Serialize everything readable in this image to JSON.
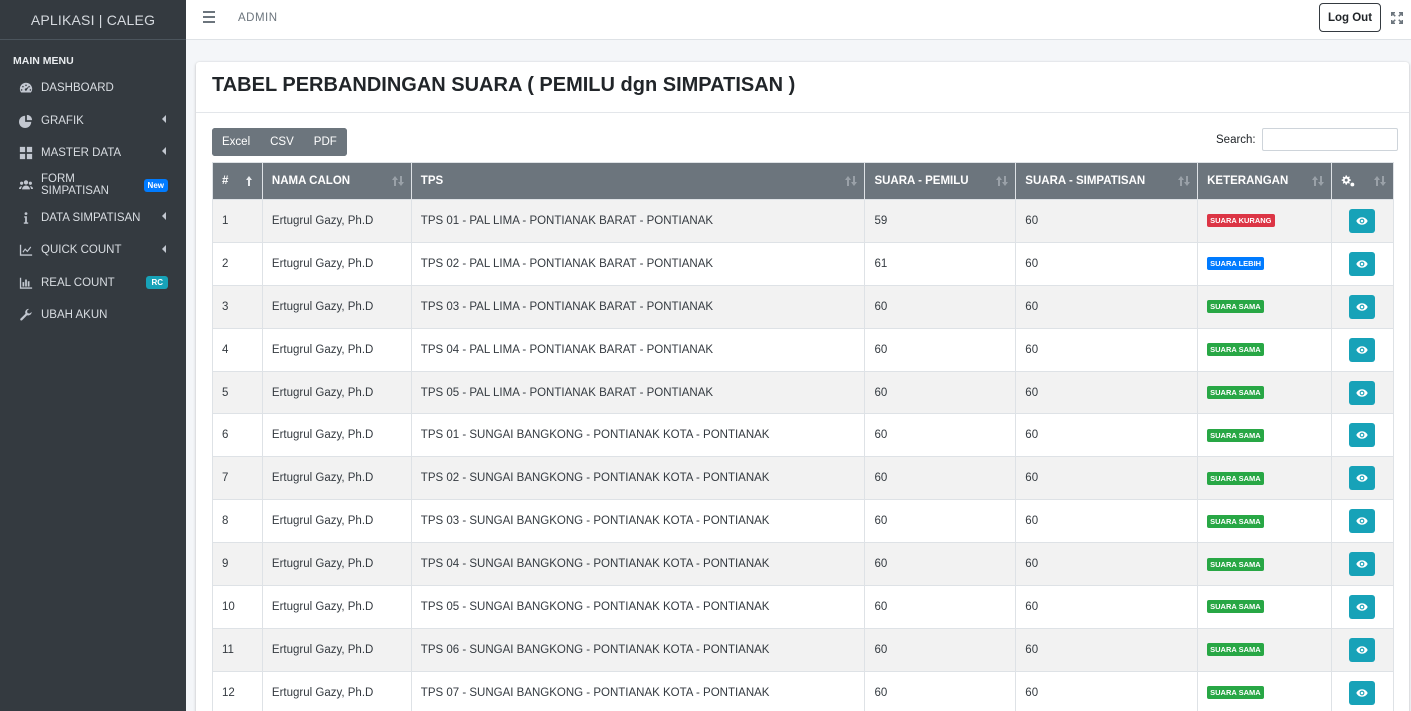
{
  "brand": "APLIKASI | CALEG",
  "sidebar": {
    "header": "MAIN MENU",
    "items": [
      {
        "label": "DASHBOARD",
        "icon": "tachometer-icon",
        "chevron": false,
        "badge": ""
      },
      {
        "label": "GRAFIK",
        "icon": "pie-chart-icon",
        "chevron": true,
        "badge": ""
      },
      {
        "label": "MASTER DATA",
        "icon": "th-large-icon",
        "chevron": true,
        "badge": ""
      },
      {
        "label": "FORM SIMPATISAN",
        "icon": "users-icon",
        "chevron": false,
        "badge": "New"
      },
      {
        "label": "DATA SIMPATISAN",
        "icon": "info-icon",
        "chevron": true,
        "badge": ""
      },
      {
        "label": "QUICK COUNT",
        "icon": "line-chart-icon",
        "chevron": true,
        "badge": ""
      },
      {
        "label": "REAL COUNT",
        "icon": "bar-chart-icon",
        "chevron": false,
        "badge": "RC"
      },
      {
        "label": "UBAH AKUN",
        "icon": "wrench-icon",
        "chevron": false,
        "badge": ""
      }
    ]
  },
  "topbar": {
    "user": "ADMIN",
    "logout_label": "Log Out"
  },
  "card": {
    "title": "TABEL PERBANDINGAN SUARA ( PEMILU dgn SIMPATISAN )"
  },
  "export_buttons": {
    "excel": "Excel",
    "csv": "CSV",
    "pdf": "PDF"
  },
  "search": {
    "label": "Search:",
    "value": ""
  },
  "table": {
    "headers": [
      "#",
      "NAMA CALON",
      "TPS",
      "SUARA - PEMILU",
      "SUARA - SIMPATISAN",
      "KETERANGAN"
    ],
    "rows": [
      {
        "no": "1",
        "nama": "Ertugrul Gazy, Ph.D",
        "tps": "TPS 01 - PAL LIMA - PONTIANAK BARAT - PONTIANAK",
        "pemilu": "59",
        "simpatisan": "60",
        "ket": "SUARA KURANG",
        "status": "kurang"
      },
      {
        "no": "2",
        "nama": "Ertugrul Gazy, Ph.D",
        "tps": "TPS 02 - PAL LIMA - PONTIANAK BARAT - PONTIANAK",
        "pemilu": "61",
        "simpatisan": "60",
        "ket": "SUARA LEBIH",
        "status": "lebih"
      },
      {
        "no": "3",
        "nama": "Ertugrul Gazy, Ph.D",
        "tps": "TPS 03 - PAL LIMA - PONTIANAK BARAT - PONTIANAK",
        "pemilu": "60",
        "simpatisan": "60",
        "ket": "SUARA SAMA",
        "status": "sama"
      },
      {
        "no": "4",
        "nama": "Ertugrul Gazy, Ph.D",
        "tps": "TPS 04 - PAL LIMA - PONTIANAK BARAT - PONTIANAK",
        "pemilu": "60",
        "simpatisan": "60",
        "ket": "SUARA SAMA",
        "status": "sama"
      },
      {
        "no": "5",
        "nama": "Ertugrul Gazy, Ph.D",
        "tps": "TPS 05 - PAL LIMA - PONTIANAK BARAT - PONTIANAK",
        "pemilu": "60",
        "simpatisan": "60",
        "ket": "SUARA SAMA",
        "status": "sama"
      },
      {
        "no": "6",
        "nama": "Ertugrul Gazy, Ph.D",
        "tps": "TPS 01 - SUNGAI BANGKONG - PONTIANAK KOTA - PONTIANAK",
        "pemilu": "60",
        "simpatisan": "60",
        "ket": "SUARA SAMA",
        "status": "sama"
      },
      {
        "no": "7",
        "nama": "Ertugrul Gazy, Ph.D",
        "tps": "TPS 02 - SUNGAI BANGKONG - PONTIANAK KOTA - PONTIANAK",
        "pemilu": "60",
        "simpatisan": "60",
        "ket": "SUARA SAMA",
        "status": "sama"
      },
      {
        "no": "8",
        "nama": "Ertugrul Gazy, Ph.D",
        "tps": "TPS 03 - SUNGAI BANGKONG - PONTIANAK KOTA - PONTIANAK",
        "pemilu": "60",
        "simpatisan": "60",
        "ket": "SUARA SAMA",
        "status": "sama"
      },
      {
        "no": "9",
        "nama": "Ertugrul Gazy, Ph.D",
        "tps": "TPS 04 - SUNGAI BANGKONG - PONTIANAK KOTA - PONTIANAK",
        "pemilu": "60",
        "simpatisan": "60",
        "ket": "SUARA SAMA",
        "status": "sama"
      },
      {
        "no": "10",
        "nama": "Ertugrul Gazy, Ph.D",
        "tps": "TPS 05 - SUNGAI BANGKONG - PONTIANAK KOTA - PONTIANAK",
        "pemilu": "60",
        "simpatisan": "60",
        "ket": "SUARA SAMA",
        "status": "sama"
      },
      {
        "no": "11",
        "nama": "Ertugrul Gazy, Ph.D",
        "tps": "TPS 06 - SUNGAI BANGKONG - PONTIANAK KOTA - PONTIANAK",
        "pemilu": "60",
        "simpatisan": "60",
        "ket": "SUARA SAMA",
        "status": "sama"
      },
      {
        "no": "12",
        "nama": "Ertugrul Gazy, Ph.D",
        "tps": "TPS 07 - SUNGAI BANGKONG - PONTIANAK KOTA - PONTIANAK",
        "pemilu": "60",
        "simpatisan": "60",
        "ket": "SUARA SAMA",
        "status": "sama"
      }
    ]
  },
  "colors": {
    "sidebar_bg": "#343a40",
    "table_header_bg": "#6c757d",
    "status_kurang": "#dc3545",
    "status_lebih": "#007bff",
    "status_sama": "#28a745",
    "action_button": "#17a2b8"
  }
}
